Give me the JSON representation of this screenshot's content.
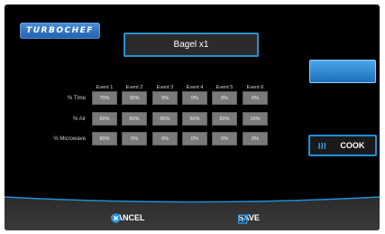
{
  "brand": {
    "logo_text": "TURBOCHEF"
  },
  "recipe": {
    "title": "Bagel x1"
  },
  "actions": {
    "top_button_label": "",
    "cook_label": "COOK"
  },
  "table": {
    "columns": [
      "Event 1",
      "Event 2",
      "Event 3",
      "Event 4",
      "Event 5",
      "Event 6"
    ],
    "rows": [
      {
        "label": "% Time",
        "values": [
          "70%",
          "30%",
          "0%",
          "0%",
          "0%",
          "0%"
        ]
      },
      {
        "label": "% Air",
        "values": [
          "60%",
          "60%",
          "60%",
          "60%",
          "60%",
          "10%"
        ]
      },
      {
        "label": "% Microwave",
        "values": [
          "80%",
          "0%",
          "0%",
          "0%",
          "0%",
          "0%"
        ]
      }
    ]
  },
  "footer": {
    "cancel_label": "CANCEL",
    "save_label": "SAVE"
  },
  "colors": {
    "accent_blue": "#1f8fd8",
    "cell_gray": "#7a7a7a",
    "background": "#000000"
  },
  "icons": {
    "cancel": "close-circle-icon",
    "save": "checkbox-check-icon",
    "cook": "heat-waves-icon"
  }
}
